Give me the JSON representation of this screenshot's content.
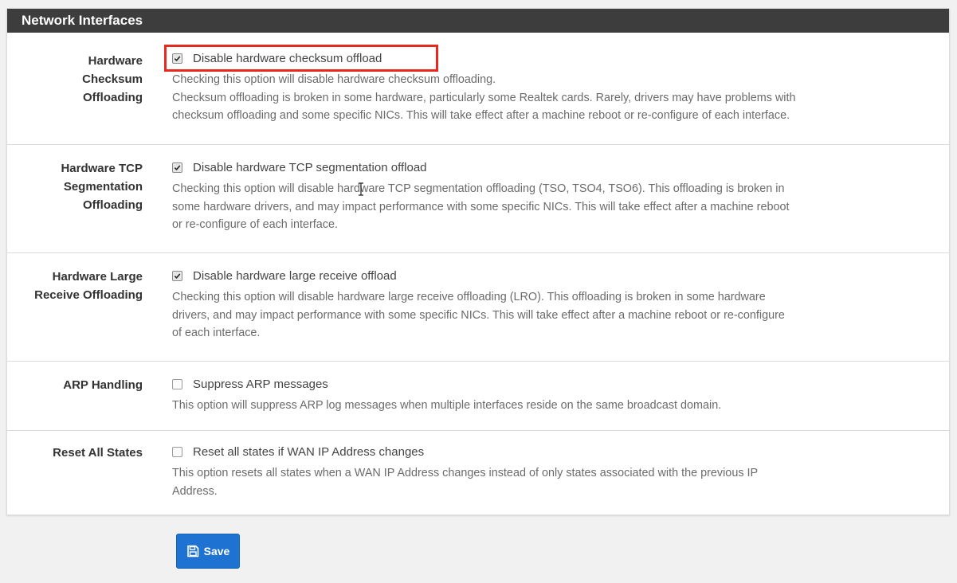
{
  "panel": {
    "title": "Network Interfaces"
  },
  "options": [
    {
      "label": "Hardware Checksum Offloading",
      "label_lines": [
        "Hardware",
        "Checksum",
        "Offloading"
      ],
      "checkbox_label": "Disable hardware checksum offload",
      "checked": true,
      "help_lines": [
        "Checking this option will disable hardware checksum offloading.",
        "Checksum offloading is broken in some hardware, particularly some Realtek cards. Rarely, drivers may have problems with",
        "checksum offloading and some specific NICs. This will take effect after a machine reboot or re-configure of each interface."
      ]
    },
    {
      "label": "Hardware TCP Segmentation Offloading",
      "label_lines": [
        "Hardware TCP",
        "Segmentation",
        "Offloading"
      ],
      "checkbox_label": "Disable hardware TCP segmentation offload",
      "checked": true,
      "help_lines": [
        "Checking this option will disable hardware TCP segmentation offloading (TSO, TSO4, TSO6). This offloading is broken in",
        "some hardware drivers, and may impact performance with some specific NICs. This will take effect after a machine reboot",
        "or re-configure of each interface."
      ]
    },
    {
      "label": "Hardware Large Receive Offloading",
      "label_lines": [
        "Hardware Large",
        "Receive Offloading"
      ],
      "checkbox_label": "Disable hardware large receive offload",
      "checked": true,
      "help_lines": [
        "Checking this option will disable hardware large receive offloading (LRO). This offloading is broken in some hardware",
        "drivers, and may impact performance with some specific NICs. This will take effect after a machine reboot or re-configure",
        "of each interface."
      ]
    },
    {
      "label": "ARP Handling",
      "label_lines": [
        "ARP Handling"
      ],
      "checkbox_label": "Suppress ARP messages",
      "checked": false,
      "help_lines": [
        "This option will suppress ARP log messages when multiple interfaces reside on the same broadcast domain."
      ]
    },
    {
      "label": "Reset All States",
      "label_lines": [
        "Reset All States"
      ],
      "checkbox_label": "Reset all states if WAN IP Address changes",
      "checked": false,
      "help_lines": [
        "This option resets all states when a WAN IP Address changes instead of only states associated with the previous IP",
        "Address."
      ]
    }
  ],
  "save_button": {
    "label": "Save",
    "icon": "floppy-disk-icon"
  },
  "colors": {
    "header_bg": "#3d3d3d",
    "highlight": "#e8291c",
    "save_bg": "#1e73d2"
  }
}
